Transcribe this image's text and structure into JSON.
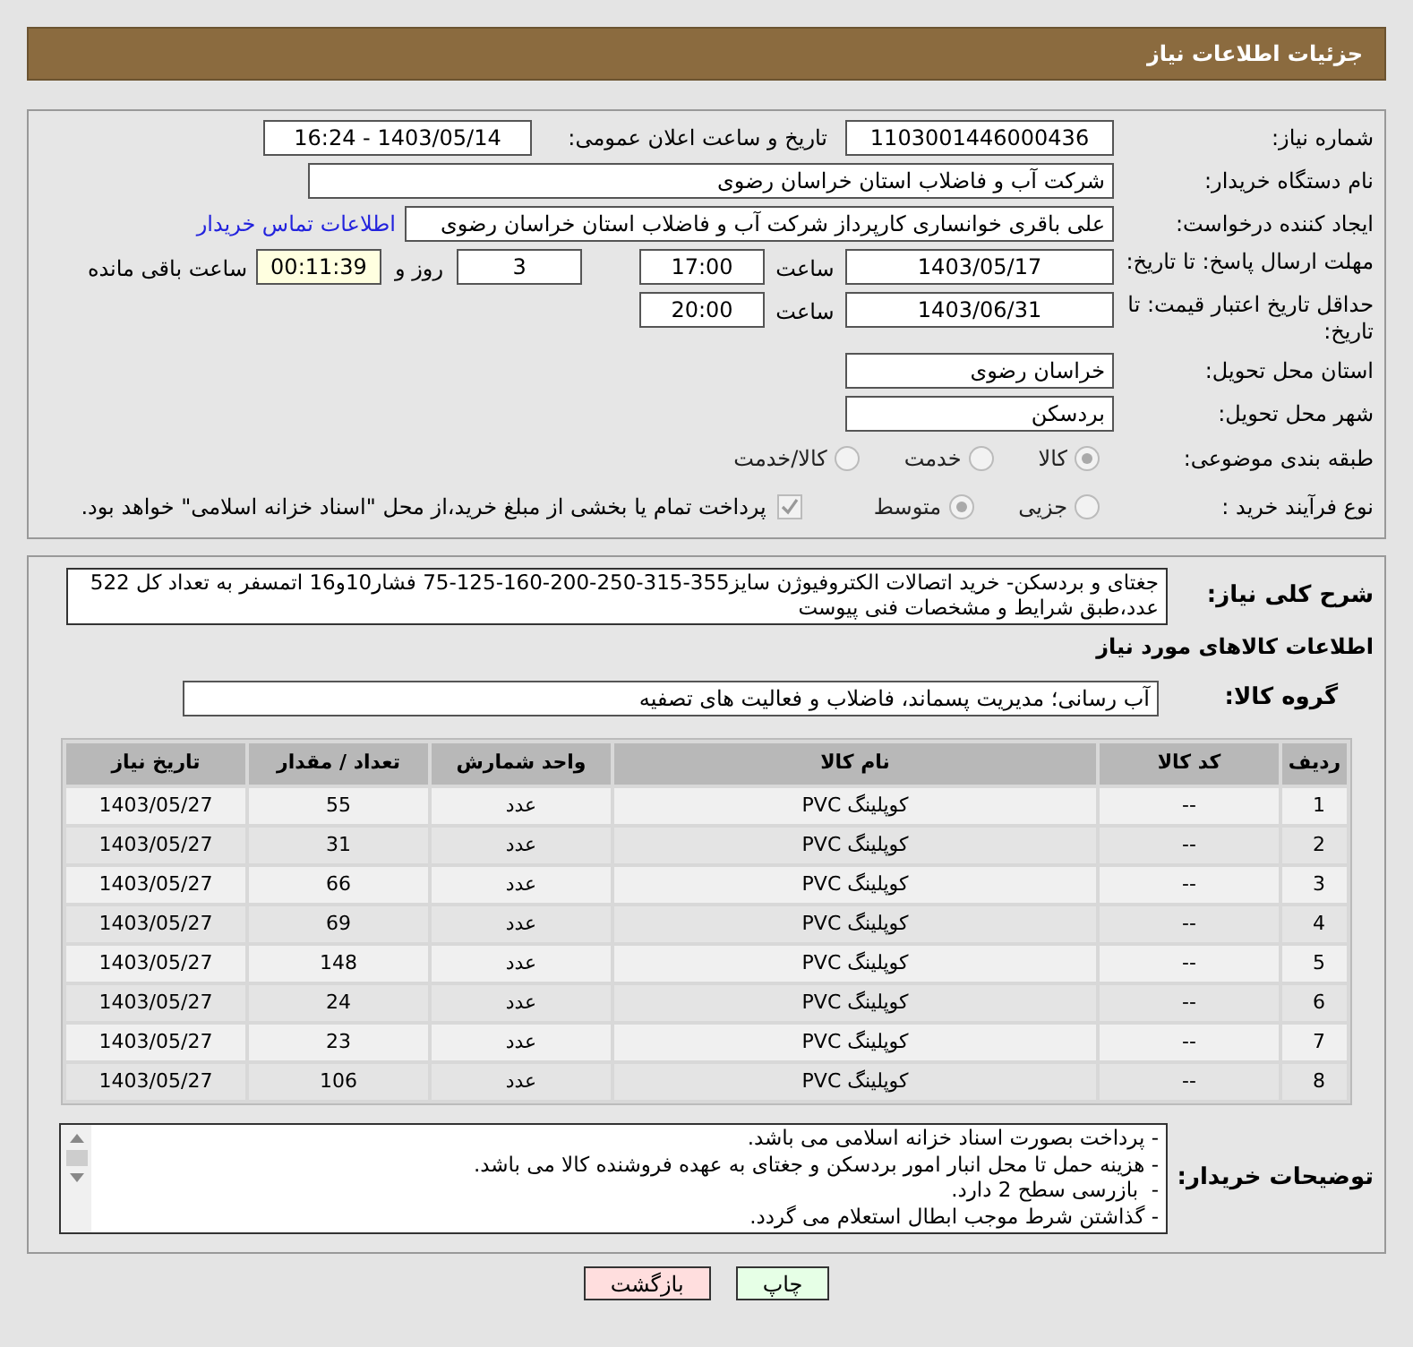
{
  "header": {
    "title": "جزئیات اطلاعات نیاز"
  },
  "details": {
    "need_number": {
      "label": "شماره نیاز:",
      "value": "1103001446000436"
    },
    "announce": {
      "label": "تاریخ و ساعت اعلان عمومی:",
      "value": "1403/05/14 - 16:24"
    },
    "buyer_org": {
      "label": "نام دستگاه خریدار:",
      "value": "شرکت آب و فاضلاب استان خراسان رضوی"
    },
    "requester": {
      "label": "ایجاد کننده درخواست:",
      "value": "علی باقری خوانساری کارپرداز شرکت آب و فاضلاب استان خراسان رضوی",
      "link": "اطلاعات تماس خریدار"
    },
    "deadline": {
      "label": "مهلت ارسال پاسخ: تا تاریخ:",
      "date": "1403/05/17",
      "time_label": "ساعت",
      "time": "17:00",
      "days": "3",
      "days_label": "روز و",
      "remaining": "00:11:39",
      "remaining_label": "ساعت باقی مانده"
    },
    "validity": {
      "label": "حداقل تاریخ اعتبار قیمت: تا تاریخ:",
      "date": "1403/06/31",
      "time_label": "ساعت",
      "time": "20:00"
    },
    "province": {
      "label": "استان محل تحویل:",
      "value": "خراسان رضوی"
    },
    "city": {
      "label": "شهر محل تحویل:",
      "value": "بردسکن"
    },
    "category": {
      "label": "طبقه بندی موضوعی:",
      "disabled": true,
      "options": [
        {
          "label": "کالا",
          "selected": true
        },
        {
          "label": "خدمت",
          "selected": false
        },
        {
          "label": "کالا/خدمت",
          "selected": false
        }
      ]
    },
    "process": {
      "label": "نوع فرآیند خرید :",
      "disabled": true,
      "options": [
        {
          "label": "جزیی",
          "selected": false
        },
        {
          "label": "متوسط",
          "selected": true
        }
      ],
      "treasury": {
        "label": "پرداخت تمام یا بخشی از مبلغ خرید،از محل \"اسناد خزانه اسلامی\" خواهد بود.",
        "checked": true
      }
    }
  },
  "needs": {
    "description": {
      "label": "شرح کلی نیاز:",
      "value": "جغتای و بردسکن- خرید اتصالات الکتروفیوژن سایز355-315-250-200-160-125-75 فشار10و16 اتمسفر به تعداد کل 522 عدد،طبق شرایط و مشخصات فنی پیوست"
    },
    "section_title": "اطلاعات کالاهای مورد نیاز",
    "group": {
      "label": "گروه کالا:",
      "value": "آب رسانی؛ مدیریت پسماند، فاضلاب و فعالیت های تصفیه"
    },
    "table": {
      "columns": [
        "ردیف",
        "کد کالا",
        "نام کالا",
        "واحد شمارش",
        "تعداد / مقدار",
        "تاریخ نیاز"
      ],
      "rows": [
        [
          "1",
          "--",
          "کوپلینگ PVC",
          "عدد",
          "55",
          "1403/05/27"
        ],
        [
          "2",
          "--",
          "کوپلینگ PVC",
          "عدد",
          "31",
          "1403/05/27"
        ],
        [
          "3",
          "--",
          "کوپلینگ PVC",
          "عدد",
          "66",
          "1403/05/27"
        ],
        [
          "4",
          "--",
          "کوپلینگ PVC",
          "عدد",
          "69",
          "1403/05/27"
        ],
        [
          "5",
          "--",
          "کوپلینگ PVC",
          "عدد",
          "148",
          "1403/05/27"
        ],
        [
          "6",
          "--",
          "کوپلینگ PVC",
          "عدد",
          "24",
          "1403/05/27"
        ],
        [
          "7",
          "--",
          "کوپلینگ PVC",
          "عدد",
          "23",
          "1403/05/27"
        ],
        [
          "8",
          "--",
          "کوپلینگ PVC",
          "عدد",
          "106",
          "1403/05/27"
        ]
      ]
    },
    "buyer_notes": {
      "label": "توضیحات خریدار:",
      "lines": [
        "- پرداخت بصورت اسناد خزانه اسلامی می باشد.",
        "- هزینه حمل تا محل انبار امور بردسکن و جغتای به عهده فروشنده کالا می باشد.",
        "-  بازرسی سطح 2 دارد.",
        "- گذاشتن شرط موجب ابطال استعلام می گردد."
      ]
    }
  },
  "buttons": [
    {
      "label": "چاپ",
      "kind": "print"
    },
    {
      "label": "بازگشت",
      "kind": "back"
    }
  ]
}
